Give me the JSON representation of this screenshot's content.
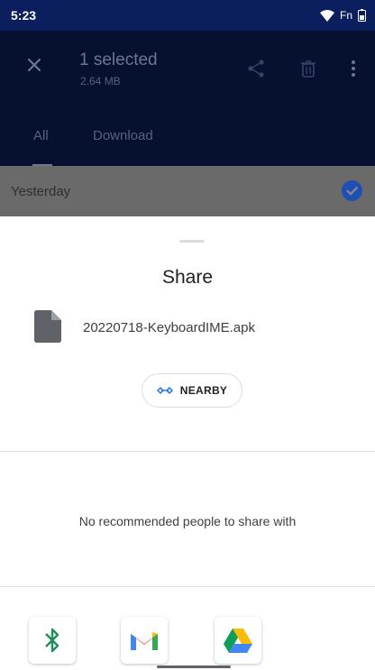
{
  "status_bar": {
    "time": "5:23",
    "network_label": "Fn"
  },
  "selection_bar": {
    "title": "1 selected",
    "subtitle": "2.64 MB"
  },
  "tabs": [
    {
      "label": "All"
    },
    {
      "label": "Download"
    }
  ],
  "list": {
    "section_label": "Yesterday"
  },
  "share_sheet": {
    "title": "Share",
    "file_name": "20220718-KeyboardIME.apk",
    "nearby_label": "NEARBY",
    "empty_message": "No recommended people to share with",
    "apps": [
      "bluetooth",
      "gmail",
      "google-drive"
    ]
  },
  "colors": {
    "appbar": "#0b1e5e",
    "accent": "#1f4fb5"
  }
}
